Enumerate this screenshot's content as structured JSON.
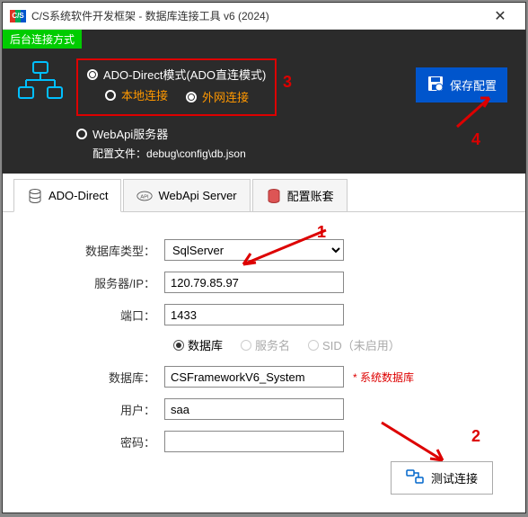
{
  "titlebar": {
    "icon_text": "C/S",
    "title": "C/S系统软件开发框架 - 数据库连接工具 v6 (2024)"
  },
  "green_tag": "后台连接方式",
  "mode": {
    "ado_direct": "ADO-Direct模式(ADO直连模式)",
    "local": "本地连接",
    "external": "外网连接",
    "webapi": "WebApi服务器",
    "config_label": "配置文件：",
    "config_path": "debug\\config\\db.json"
  },
  "save_btn": "保存配置",
  "tabs": {
    "t1": "ADO-Direct",
    "t2": "WebApi Server",
    "t3": "配置账套"
  },
  "form": {
    "dbtype_label": "数据库类型：",
    "dbtype_value": "SqlServer",
    "server_label": "服务器/IP：",
    "server_value": "120.79.85.97",
    "port_label": "端口：",
    "port_value": "1433",
    "r_database": "数据库",
    "r_service": "服务名",
    "r_sid": "SID（未启用）",
    "db_label": "数据库：",
    "db_value": "CSFrameworkV6_System",
    "db_note": "* 系统数据库",
    "user_label": "用户：",
    "user_value": "saa",
    "pwd_label": "密码：",
    "pwd_value": ""
  },
  "test_btn": "测试连接",
  "annotations": {
    "a1": "1",
    "a2": "2",
    "a3": "3",
    "a4": "4"
  }
}
